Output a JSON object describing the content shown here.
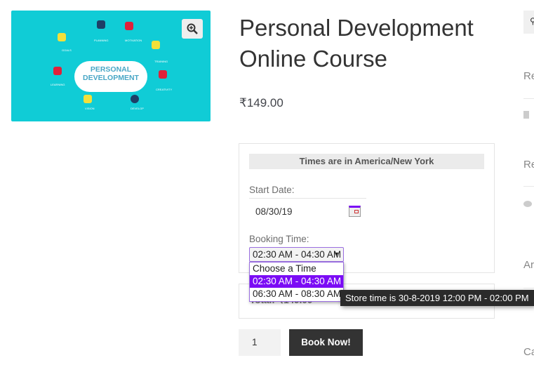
{
  "product": {
    "image": {
      "heading": "PERSONAL DEVELOPMENT",
      "labels": [
        "GOALS",
        "PLANNING",
        "MOTIVATION",
        "TRAINING",
        "CREATIVITY",
        "DEVELOP",
        "VISION",
        "LEARNING"
      ],
      "background": "#10ccd6"
    },
    "title": "Personal Development Online Course",
    "price": "₹149.00"
  },
  "booking": {
    "timezone_note": "Times are in America/New York",
    "start_date_label": "Start Date:",
    "start_date_value": "08/30/19",
    "booking_time_label": "Booking Time:",
    "selected_time": "02:30 AM - 04:30 AM",
    "options": [
      "Choose a Time",
      "02:30 AM - 04:30 AM",
      "06:30 AM - 08:30 AM"
    ],
    "tooltip": "Store time is 30-8-2019 12:00 PM - 02:00 PM",
    "total": "Total: ₹149.00",
    "quantity": "1",
    "book_button": "Book Now!",
    "accent": "#7b0cf5"
  },
  "sidebar": {
    "items": [
      "Re",
      "Re",
      "Ar",
      "Ca"
    ]
  }
}
